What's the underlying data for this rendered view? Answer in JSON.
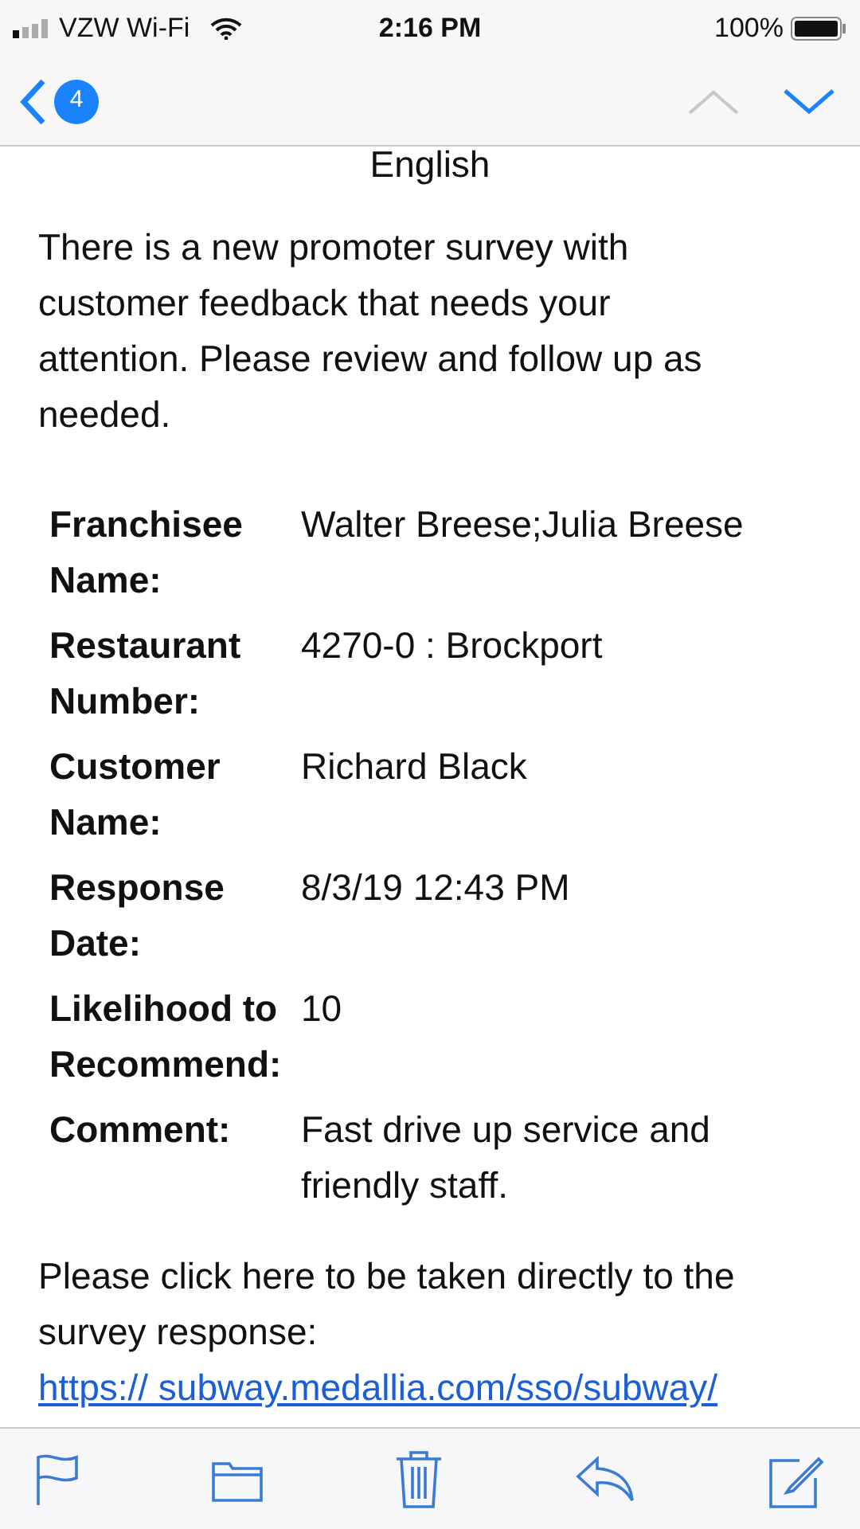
{
  "status_bar": {
    "carrier": "VZW Wi-Fi",
    "time": "2:16 PM",
    "battery": "100%"
  },
  "nav": {
    "unread_count": "4",
    "previous_disabled": true,
    "next_disabled": false
  },
  "email": {
    "heading": "English",
    "intro": "There is a new promoter survey with customer feedback that needs your attention. Please review and follow up as needed.",
    "fields": [
      {
        "label": "Franchisee Name:",
        "value": "Walter Breese;Julia Breese"
      },
      {
        "label": "Restaurant Number:",
        "value": "4270-0 : Brockport"
      },
      {
        "label": "Customer Name:",
        "value": "Richard Black"
      },
      {
        "label": "Response Date:",
        "value": "8/3/19 12:43 PM"
      },
      {
        "label": "Likelihood to Recommend:",
        "value": "10"
      },
      {
        "label": "Comment:",
        "value": "Fast drive up service and friendly staff."
      }
    ],
    "footer_text": "Please click here to be taken directly to the survey response:",
    "link": " https:// subway.medallia.com/sso/subway/"
  }
}
